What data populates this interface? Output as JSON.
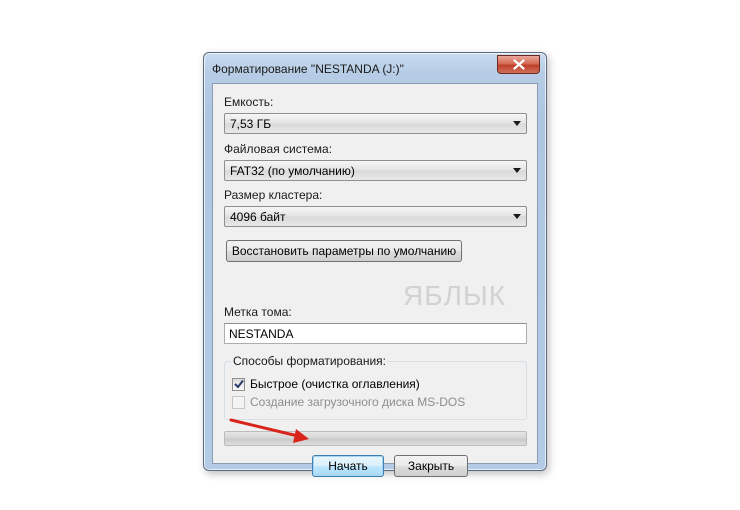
{
  "dialog": {
    "title": "Форматирование \"NESTANDA (J:)\"",
    "capacity": {
      "label": "Емкость:",
      "value": "7,53 ГБ"
    },
    "filesystem": {
      "label": "Файловая система:",
      "value": "FAT32 (по умолчанию)"
    },
    "cluster": {
      "label": "Размер кластера:",
      "value": "4096 байт"
    },
    "restore_defaults_label": "Восстановить параметры по умолчанию",
    "volume": {
      "label": "Метка тома:",
      "value": "NESTANDA"
    },
    "format_options": {
      "title": "Способы форматирования:",
      "quick": {
        "label": "Быстрое (очистка оглавления)",
        "checked": true
      },
      "msdos": {
        "label": "Создание загрузочного диска MS-DOS",
        "checked": false,
        "disabled": true
      }
    },
    "progress": 0,
    "start_label": "Начать",
    "close_label": "Закрыть"
  },
  "watermark": "ЯБЛЫК",
  "annotation_arrow_color": "#d9241b",
  "icons": {
    "close": "close-icon",
    "checkmark": "checkmark-icon",
    "dropdown": "chevron-down-icon",
    "logo": "apple-icon"
  }
}
